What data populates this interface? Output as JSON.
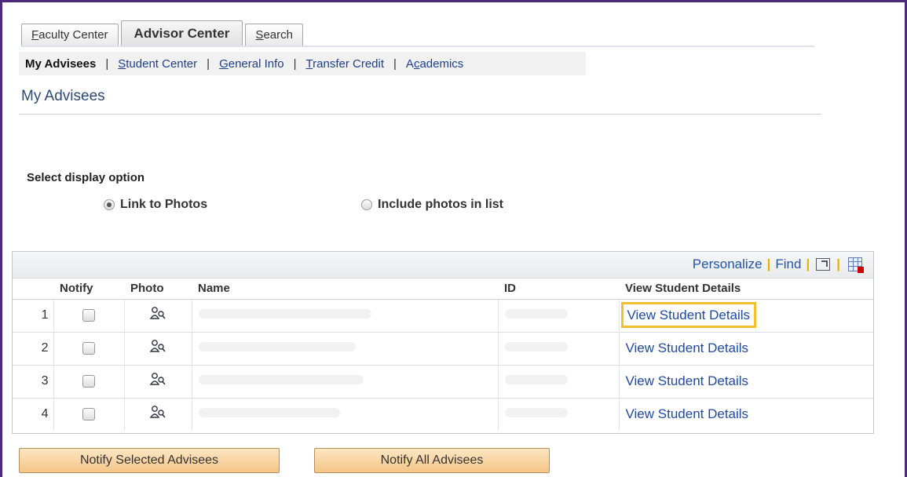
{
  "tabs": [
    {
      "prefix": "",
      "key": "F",
      "rest": "aculty Center"
    },
    {
      "label": "Advisor Center"
    },
    {
      "prefix": "",
      "key": "S",
      "rest": "earch"
    }
  ],
  "subnav": {
    "current": "My Advisees",
    "items": [
      {
        "prefix": "",
        "key": "S",
        "rest": "tudent Center"
      },
      {
        "prefix": "",
        "key": "G",
        "rest": "eneral Info"
      },
      {
        "prefix": "",
        "key": "T",
        "rest": "ransfer Credit"
      },
      {
        "prefix": "A",
        "key": "c",
        "rest": "ademics"
      }
    ],
    "separator": "|"
  },
  "page_title": "My Advisees",
  "display": {
    "label": "Select display option",
    "options": [
      {
        "label": "Link to Photos",
        "checked": true
      },
      {
        "label": "Include photos in list",
        "checked": false
      }
    ]
  },
  "grid": {
    "toolbar": {
      "personalize": "Personalize",
      "find": "Find",
      "separator": "|"
    },
    "columns": [
      "Notify",
      "Photo",
      "Name",
      "ID",
      "View Student Details"
    ],
    "rows": [
      {
        "num": "1",
        "link": "View Student Details"
      },
      {
        "num": "2",
        "link": "View Student Details"
      },
      {
        "num": "3",
        "link": "View Student Details"
      },
      {
        "num": "4",
        "link": "View Student Details"
      }
    ]
  },
  "buttons": {
    "notify_selected": "Notify Selected Advisees",
    "notify_all": "Notify All Advisees"
  },
  "colors": {
    "frame": "#4b2a7a",
    "link": "#1f4aa0",
    "highlight": "#f2c028",
    "button": "#f3c586"
  },
  "icons": {
    "photo": "person-search-icon",
    "zoom": "zoom-grid-icon",
    "download": "download-excel-icon"
  }
}
